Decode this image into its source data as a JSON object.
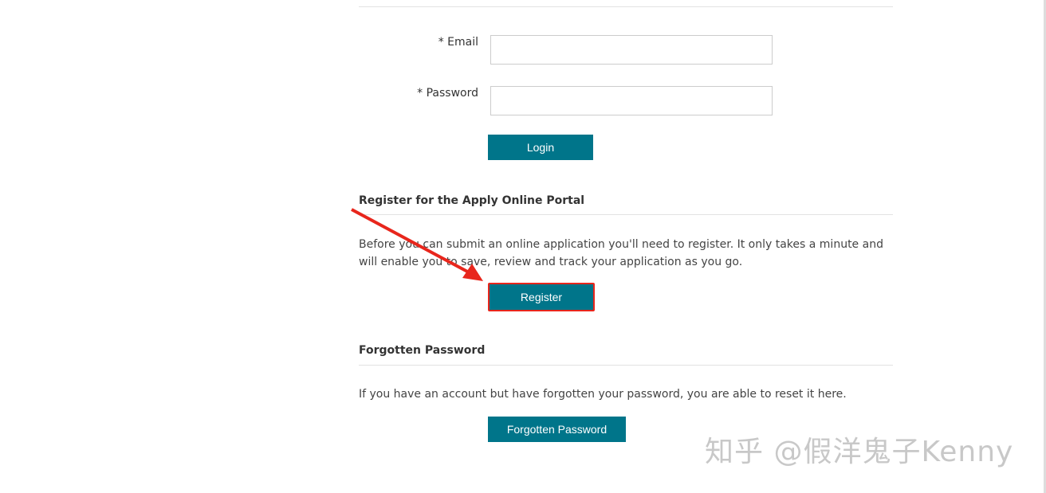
{
  "login": {
    "email_label": "*  Email",
    "password_label": "*  Password",
    "email_value": "",
    "password_value": "",
    "login_button": "Login"
  },
  "register": {
    "heading": "Register for the Apply Online Portal",
    "text_line1": "Before you can submit an online application you'll need to register. It only takes a minute and",
    "text_line2": "will enable you to save, review and track your application as you go.",
    "button": "Register"
  },
  "forgot": {
    "heading": "Forgotten Password",
    "text": "If you have an account but have forgotten your password, you are able to reset it here.",
    "button": "Forgotten Password"
  },
  "watermark": "知乎 @假洋鬼子Kenny",
  "annotation_color": "#e8261c",
  "accent": "#00758a"
}
